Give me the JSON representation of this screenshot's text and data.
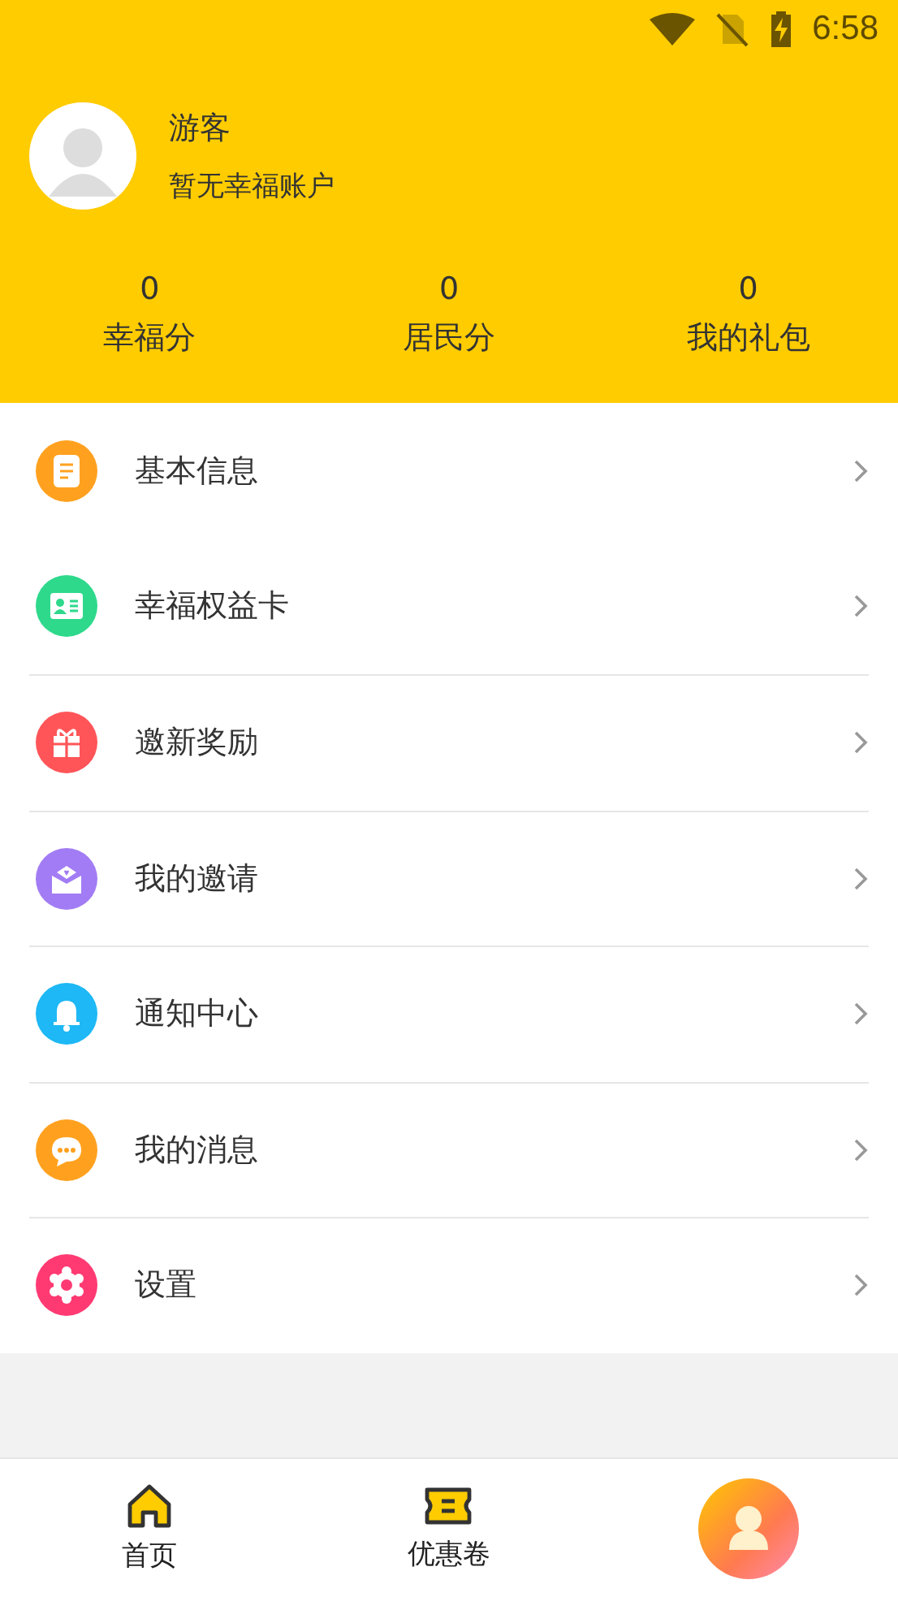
{
  "status_bar": {
    "time": "6:58"
  },
  "profile": {
    "name": "游客",
    "subtitle": "暂无幸福账户"
  },
  "stats": [
    {
      "value": "0",
      "label": "幸福分"
    },
    {
      "value": "0",
      "label": "居民分"
    },
    {
      "value": "0",
      "label": "我的礼包"
    }
  ],
  "menu": [
    {
      "label": "基本信息",
      "kind": "document",
      "color": "#ffa11f"
    },
    {
      "label": "幸福权益卡",
      "kind": "card",
      "color": "#2ed98c"
    },
    {
      "label": "邀新奖励",
      "kind": "gift",
      "color": "#ff5558"
    },
    {
      "label": "我的邀请",
      "kind": "mail",
      "color": "#a27cf4"
    },
    {
      "label": "通知中心",
      "kind": "bell",
      "color": "#1db8f5"
    },
    {
      "label": "我的消息",
      "kind": "chat",
      "color": "#ffa11f"
    },
    {
      "label": "设置",
      "kind": "gear",
      "color": "#ff3a73"
    }
  ],
  "bottom_nav": [
    {
      "kind": "home",
      "label": "首页"
    },
    {
      "kind": "coupon",
      "label": "优惠卷"
    },
    {
      "kind": "profile"
    }
  ]
}
